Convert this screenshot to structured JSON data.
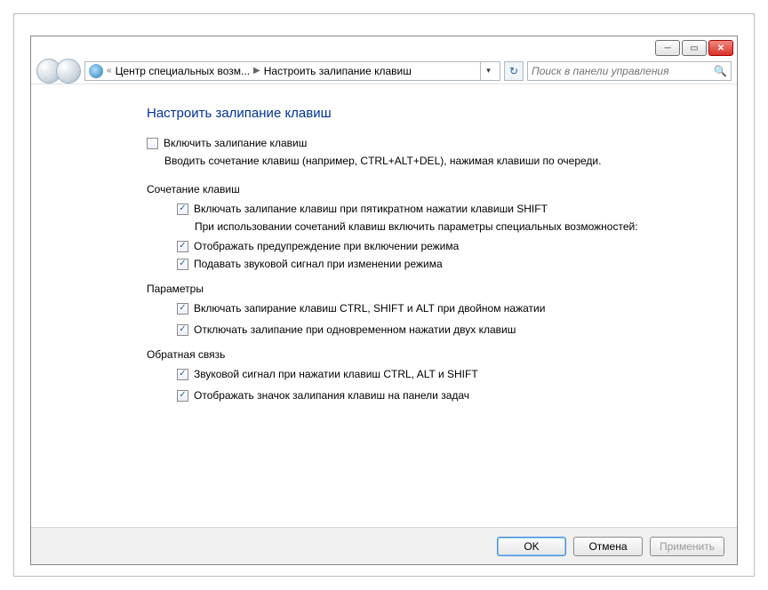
{
  "breadcrumb": {
    "seg1": "Центр специальных возм...",
    "seg2": "Настроить залипание клавиш"
  },
  "search": {
    "placeholder": "Поиск в панели управления"
  },
  "page": {
    "title": "Настроить залипание клавиш",
    "main_check": "Включить залипание клавиш",
    "main_desc": "Вводить сочетание клавиш (например, CTRL+ALT+DEL), нажимая клавиши по очереди."
  },
  "sec1": {
    "title": "Сочетание клавиш",
    "c1": "Включать залипание клавиш при пятикратном нажатии клавиши SHIFT",
    "sub": "При использовании сочетаний клавиш включить параметры специальных возможностей:",
    "c2": "Отображать предупреждение при включении режима",
    "c3": "Подавать звуковой сигнал при изменении режима"
  },
  "sec2": {
    "title": "Параметры",
    "c1": "Включать запирание клавиш CTRL, SHIFT и ALT при двойном нажатии",
    "c2": "Отключать залипание при одновременном нажатии двух клавиш"
  },
  "sec3": {
    "title": "Обратная связь",
    "c1": "Звуковой сигнал при нажатии клавиш CTRL, ALT и SHIFT",
    "c2": "Отображать значок залипания клавиш на панели задач"
  },
  "buttons": {
    "ok": "OK",
    "cancel": "Отмена",
    "apply": "Применить"
  }
}
